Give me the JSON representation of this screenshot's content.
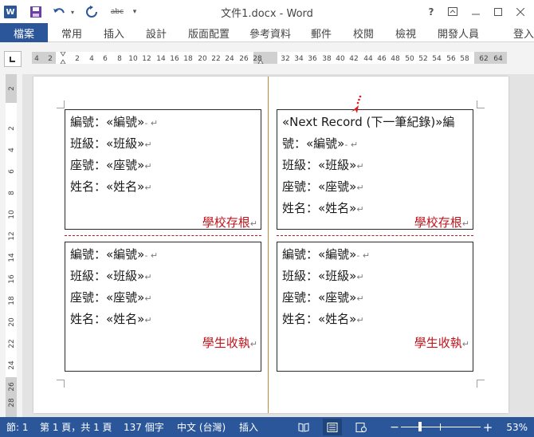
{
  "titlebar": {
    "title": "文件1.docx - Word",
    "app_icon_letter": "W",
    "abc_label": "abc",
    "help_label": "?"
  },
  "ribbon": {
    "file_tab": "檔案",
    "tabs": [
      "常用",
      "插入",
      "設計",
      "版面配置",
      "參考資料",
      "郵件",
      "校閱",
      "檢視",
      "開發人員"
    ],
    "signin": "登入"
  },
  "rulers": {
    "horizontal_labels": [
      "4",
      "2",
      "2",
      "4",
      "6",
      "8",
      "10",
      "12",
      "14",
      "16",
      "18",
      "20",
      "22",
      "24",
      "26",
      "28",
      "32",
      "34",
      "36",
      "38",
      "40",
      "42",
      "44",
      "46",
      "48",
      "50",
      "52",
      "54",
      "56",
      "58",
      "62",
      "64"
    ],
    "vertical_labels": [
      "2",
      "2",
      "4",
      "6",
      "8",
      "10",
      "12",
      "14",
      "16",
      "18",
      "20",
      "22",
      "24",
      "26",
      "28"
    ]
  },
  "document": {
    "cards": [
      {
        "lines": [
          {
            "text": "編號：«編號»",
            "mark": "- ↵"
          },
          {
            "text": "班級：«班級»",
            "mark": "↵"
          },
          {
            "text": "座號：«座號»",
            "mark": "↵"
          },
          {
            "text": "姓名：«姓名»",
            "mark": "↵"
          }
        ],
        "label": "學校存根",
        "label_mark": "↵"
      },
      {
        "lines": [
          {
            "text": "«Next Record (下一筆紀錄)»編",
            "mark": ""
          },
          {
            "text": "號：«編號»",
            "mark": "- ↵"
          },
          {
            "text": "班級：«班級»",
            "mark": "↵"
          },
          {
            "text": "座號：«座號»",
            "mark": "↵"
          },
          {
            "text": "姓名：«姓名»",
            "mark": "↵"
          }
        ],
        "label": "學校存根",
        "label_mark": "↵"
      },
      {
        "lines": [
          {
            "text": "編號：«編號»",
            "mark": "- ↵"
          },
          {
            "text": "班級：«班級»",
            "mark": "↵"
          },
          {
            "text": "座號：«座號»",
            "mark": "↵"
          },
          {
            "text": "姓名：«姓名»",
            "mark": "↵"
          }
        ],
        "label": "學生收執",
        "label_mark": "↵"
      },
      {
        "lines": [
          {
            "text": "編號：«編號»",
            "mark": "- ↵"
          },
          {
            "text": "班級：«班級»",
            "mark": "↵"
          },
          {
            "text": "座號：«座號»",
            "mark": "↵"
          },
          {
            "text": "姓名：«姓名»",
            "mark": "↵"
          }
        ],
        "label": "學生收執",
        "label_mark": "↵"
      }
    ]
  },
  "statusbar": {
    "section": "節: 1",
    "page": "第 1 頁，共 1 頁",
    "words": "137 個字",
    "language": "中文 (台灣)",
    "mode": "插入",
    "zoom_minus": "−",
    "zoom_plus": "+",
    "zoom_percent": "53%",
    "zoom_level_percent": 53
  },
  "colors": {
    "accent": "#2b579a",
    "stamp_label": "#c0141c",
    "column_separator": "#c08a40"
  }
}
